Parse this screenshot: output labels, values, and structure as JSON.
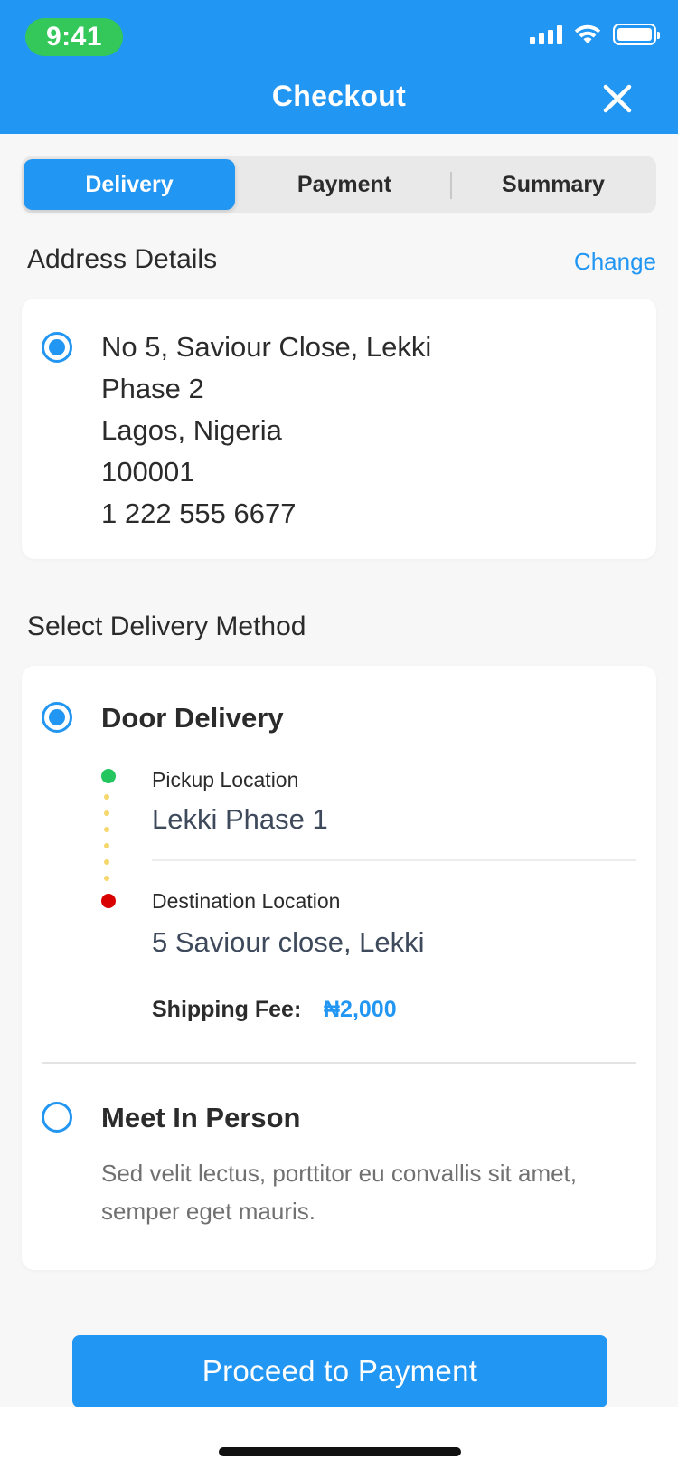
{
  "status_bar": {
    "time": "9:41"
  },
  "header": {
    "title": "Checkout",
    "close_icon": "close-icon"
  },
  "tabs": [
    {
      "label": "Delivery",
      "active": true
    },
    {
      "label": "Payment",
      "active": false
    },
    {
      "label": "Summary",
      "active": false
    }
  ],
  "address": {
    "section_title": "Address Details",
    "change_label": "Change",
    "lines": [
      "No 5, Saviour Close, Lekki",
      "Phase 2",
      "Lagos, Nigeria",
      "100001",
      "1 222 555 6677"
    ],
    "selected": true
  },
  "delivery": {
    "section_title": "Select Delivery Method",
    "door": {
      "title": "Door Delivery",
      "selected": true,
      "pickup_label": "Pickup Location",
      "pickup_value": "Lekki Phase 1",
      "destination_label": "Destination Location",
      "destination_value": "5 Saviour close, Lekki",
      "fee_label": "Shipping Fee:",
      "fee_value": "₦2,000"
    },
    "meet": {
      "title": "Meet In Person",
      "selected": false,
      "description": "Sed velit lectus, porttitor eu convallis sit amet, semper eget mauris."
    }
  },
  "cta": {
    "label": "Proceed to Payment"
  },
  "colors": {
    "primary": "#2296f3",
    "pickup_dot": "#22c55e",
    "destination_dot": "#d90000",
    "trail": "#f6d76b",
    "time_pill": "#34c759"
  }
}
